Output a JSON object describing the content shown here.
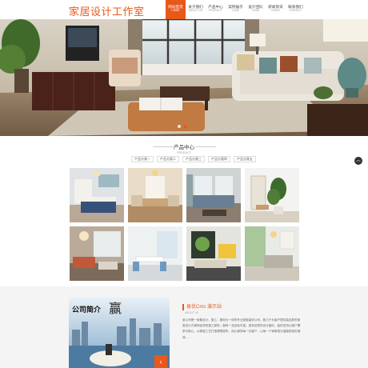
{
  "header": {
    "logo": "家居设计工作室",
    "nav": [
      {
        "zh": "网站首页",
        "en": "HOME",
        "active": true
      },
      {
        "zh": "关于我们",
        "en": "ABOUT US",
        "active": false
      },
      {
        "zh": "产品中心",
        "en": "PRODUCT",
        "active": false
      },
      {
        "zh": "案例展示",
        "en": "CASE",
        "active": false
      },
      {
        "zh": "设计团队",
        "en": "TEAM",
        "active": false
      },
      {
        "zh": "新闻资讯",
        "en": "NEWS",
        "active": false
      },
      {
        "zh": "联系我们",
        "en": "CONTACT",
        "active": false
      }
    ]
  },
  "banner": {
    "active_dot": 1,
    "dot_count": 2
  },
  "products": {
    "title": "产品中心",
    "subtitle": "PRODUCT",
    "categories": [
      "产品分类一",
      "产品分类二",
      "产品分类三",
      "产品分类四",
      "产品分类五"
    ],
    "thumb_count": 8
  },
  "about": {
    "image_title": "公司简介",
    "image_big_char": "赢",
    "heading": "易优Cms 演示站",
    "subheading": "ABOUT US",
    "text": "某公司是一家集设计、施工、服务为一体的专业家居装饰公司，致力于为客户提供高品质的家居设计方案和优质的施工服务，拥有一支经验丰富、富有创意的设计团队，始终坚持以客户需求为核心，以精湛工艺打造理想居所，用心服务每一位客户，让每一个家都成为温馨舒适的港湾……"
  },
  "colors": {
    "accent": "#e8581a"
  }
}
